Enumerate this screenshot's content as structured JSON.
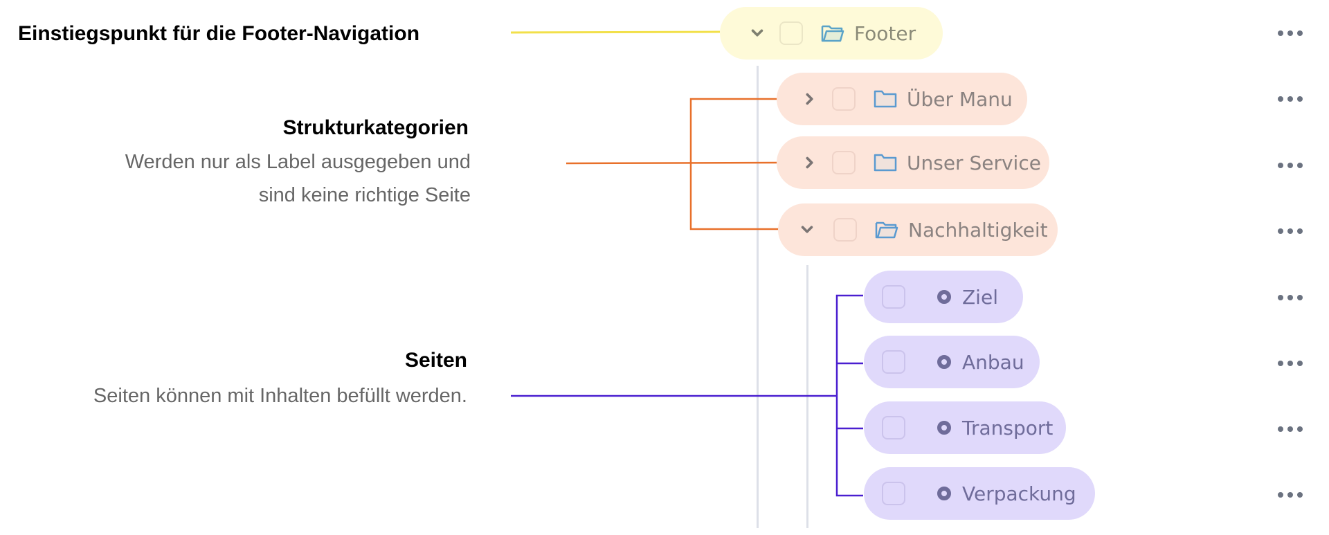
{
  "annotations": {
    "entry": {
      "title": "Einstiegspunkt für die Footer-Navigation",
      "color": "#f2e04a"
    },
    "categories": {
      "title": "Strukturkategorien",
      "desc_line1": "Werden nur als Label ausgegeben und",
      "desc_line2": "sind keine richtige Seite",
      "color": "#e8702a"
    },
    "pages": {
      "title": "Seiten",
      "desc": "Seiten können mit Inhalten befüllt werden.",
      "color": "#4a1fd0"
    }
  },
  "tree": {
    "root": {
      "label": "Footer",
      "icon": "folder-open-icon",
      "expanded": true,
      "checked": false
    },
    "categories": [
      {
        "label": "Über Manu",
        "icon": "folder-icon",
        "expanded": false,
        "checked": false
      },
      {
        "label": "Unser Service",
        "icon": "folder-icon",
        "expanded": false,
        "checked": false
      },
      {
        "label": "Nachhaltigkeit",
        "icon": "folder-open-icon",
        "expanded": true,
        "checked": false
      }
    ],
    "pages": [
      {
        "label": "Ziel",
        "icon": "page-dot-icon",
        "checked": false
      },
      {
        "label": "Anbau",
        "icon": "page-dot-icon",
        "checked": false
      },
      {
        "label": "Transport",
        "icon": "page-dot-icon",
        "checked": false
      },
      {
        "label": "Verpackung",
        "icon": "page-dot-icon",
        "checked": false
      }
    ],
    "more_icon": "more-horizontal-icon"
  },
  "colors": {
    "root_bg": "#fefad8",
    "category_bg": "#fde5da",
    "page_bg": "#e0d9fb",
    "folder_stroke": "#5aa3c8"
  }
}
